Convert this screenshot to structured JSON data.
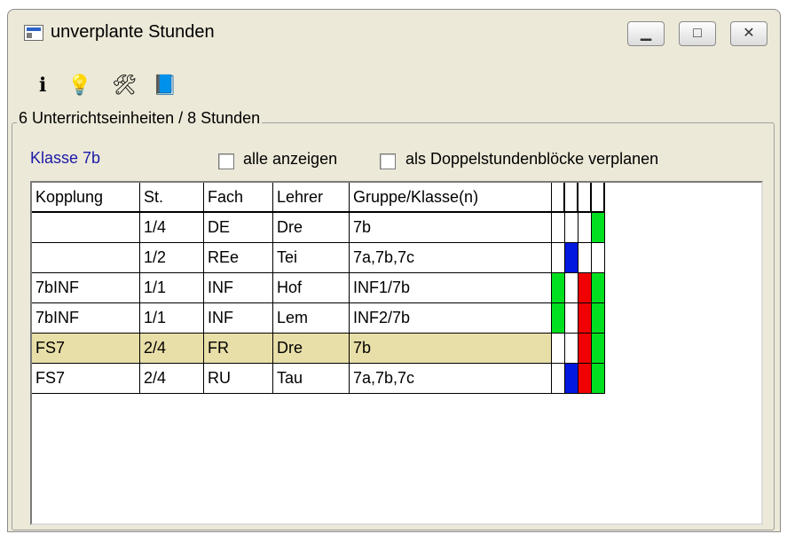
{
  "window": {
    "title": "unverplante Stunden"
  },
  "titlebar_buttons": {
    "minimize": "▁",
    "maximize": "□",
    "close": "✕"
  },
  "toolbar": {
    "items": [
      {
        "icon": "info-icon",
        "glyph": "ℹ"
      },
      {
        "icon": "lightbulb-icon",
        "glyph": "💡"
      },
      {
        "icon": "tools-icon",
        "glyph": "🛠"
      },
      {
        "icon": "book-icon",
        "glyph": "📘"
      }
    ]
  },
  "group": {
    "title": "6 Unterrichtseinheiten / 8 Stunden"
  },
  "klasse": "Klasse 7b",
  "options": {
    "show_all": {
      "label": "alle anzeigen",
      "checked": false
    },
    "double_blocks": {
      "label": "als Doppelstundenblöcke verplanen",
      "checked": false
    }
  },
  "table": {
    "columns": [
      "Kopplung",
      "St.",
      "Fach",
      "Lehrer",
      "Gruppe/Klasse(n)"
    ],
    "rows": [
      {
        "kopplung": "",
        "st": "1/4",
        "fach": "DE",
        "lehrer": "Dre",
        "gruppe": "7b",
        "flags": [
          "",
          "",
          "",
          "green"
        ],
        "selected": false
      },
      {
        "kopplung": "",
        "st": "1/2",
        "fach": "REe",
        "lehrer": "Tei",
        "gruppe": "7a,7b,7c",
        "flags": [
          "",
          "blue",
          "",
          ""
        ],
        "selected": false
      },
      {
        "kopplung": "7bINF",
        "st": "1/1",
        "fach": "INF",
        "lehrer": "Hof",
        "gruppe": "INF1/7b",
        "flags": [
          "green",
          "",
          "red",
          "green"
        ],
        "selected": false
      },
      {
        "kopplung": "7bINF",
        "st": "1/1",
        "fach": "INF",
        "lehrer": "Lem",
        "gruppe": "INF2/7b",
        "flags": [
          "green",
          "",
          "red",
          "green"
        ],
        "selected": false
      },
      {
        "kopplung": "FS7",
        "st": "2/4",
        "fach": "FR",
        "lehrer": "Dre",
        "gruppe": "7b",
        "flags": [
          "",
          "",
          "red",
          "green"
        ],
        "selected": true
      },
      {
        "kopplung": "FS7",
        "st": "2/4",
        "fach": "RU",
        "lehrer": "Tau",
        "gruppe": "7a,7b,7c",
        "flags": [
          "",
          "blue",
          "red",
          "green"
        ],
        "selected": false
      }
    ]
  },
  "colors": {
    "green": "#00e020",
    "blue": "#0018e0",
    "red": "#f00000",
    "selected_row": "#e8dfa8"
  }
}
